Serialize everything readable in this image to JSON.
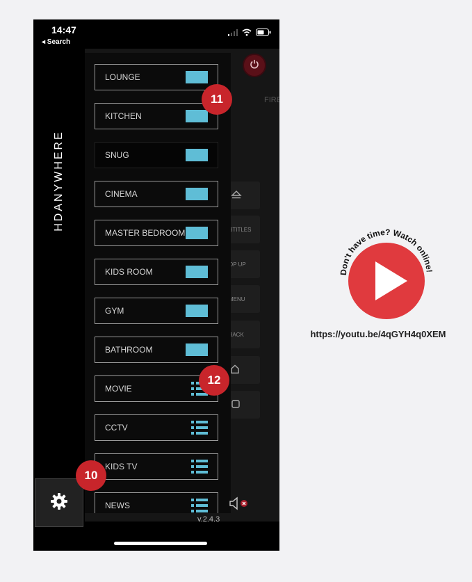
{
  "status": {
    "time": "14:47",
    "back_label": "◂ Search"
  },
  "brand": "HDANYWHERE",
  "background": {
    "fire_label": "FIRE",
    "side_buttons": [
      "",
      "BTITLES",
      "OP UP",
      "MENU",
      "BACK",
      "",
      ""
    ]
  },
  "rooms": [
    {
      "label": "LOUNGE",
      "kind": "swatch"
    },
    {
      "label": "KITCHEN",
      "kind": "swatch"
    },
    {
      "label": "SNUG",
      "kind": "swatch"
    },
    {
      "label": "CINEMA",
      "kind": "swatch"
    },
    {
      "label": "MASTER BEDROOM",
      "kind": "swatch"
    },
    {
      "label": "KIDS ROOM",
      "kind": "swatch"
    },
    {
      "label": "GYM",
      "kind": "swatch"
    },
    {
      "label": "BATHROOM",
      "kind": "swatch"
    },
    {
      "label": "MOVIE",
      "kind": "list"
    },
    {
      "label": "CCTV",
      "kind": "list"
    },
    {
      "label": "KIDS TV",
      "kind": "list"
    },
    {
      "label": "NEWS",
      "kind": "list"
    }
  ],
  "badges": {
    "a": "11",
    "b": "12",
    "c": "10"
  },
  "version": "v.2.4.3",
  "promo": {
    "curved_text": "Don't have time? Watch online!",
    "url": "https://youtu.be/4qGYH4q0XEM"
  },
  "colors": {
    "accent": "#5fbdd6",
    "badge": "#c8252b",
    "youtube_red": "#e03a3e"
  },
  "icons": [
    "signal-icon",
    "wifi-icon",
    "battery-icon",
    "power-icon",
    "eject-icon",
    "home-icon",
    "stop-icon",
    "gear-icon",
    "mute-icon",
    "play-icon"
  ]
}
